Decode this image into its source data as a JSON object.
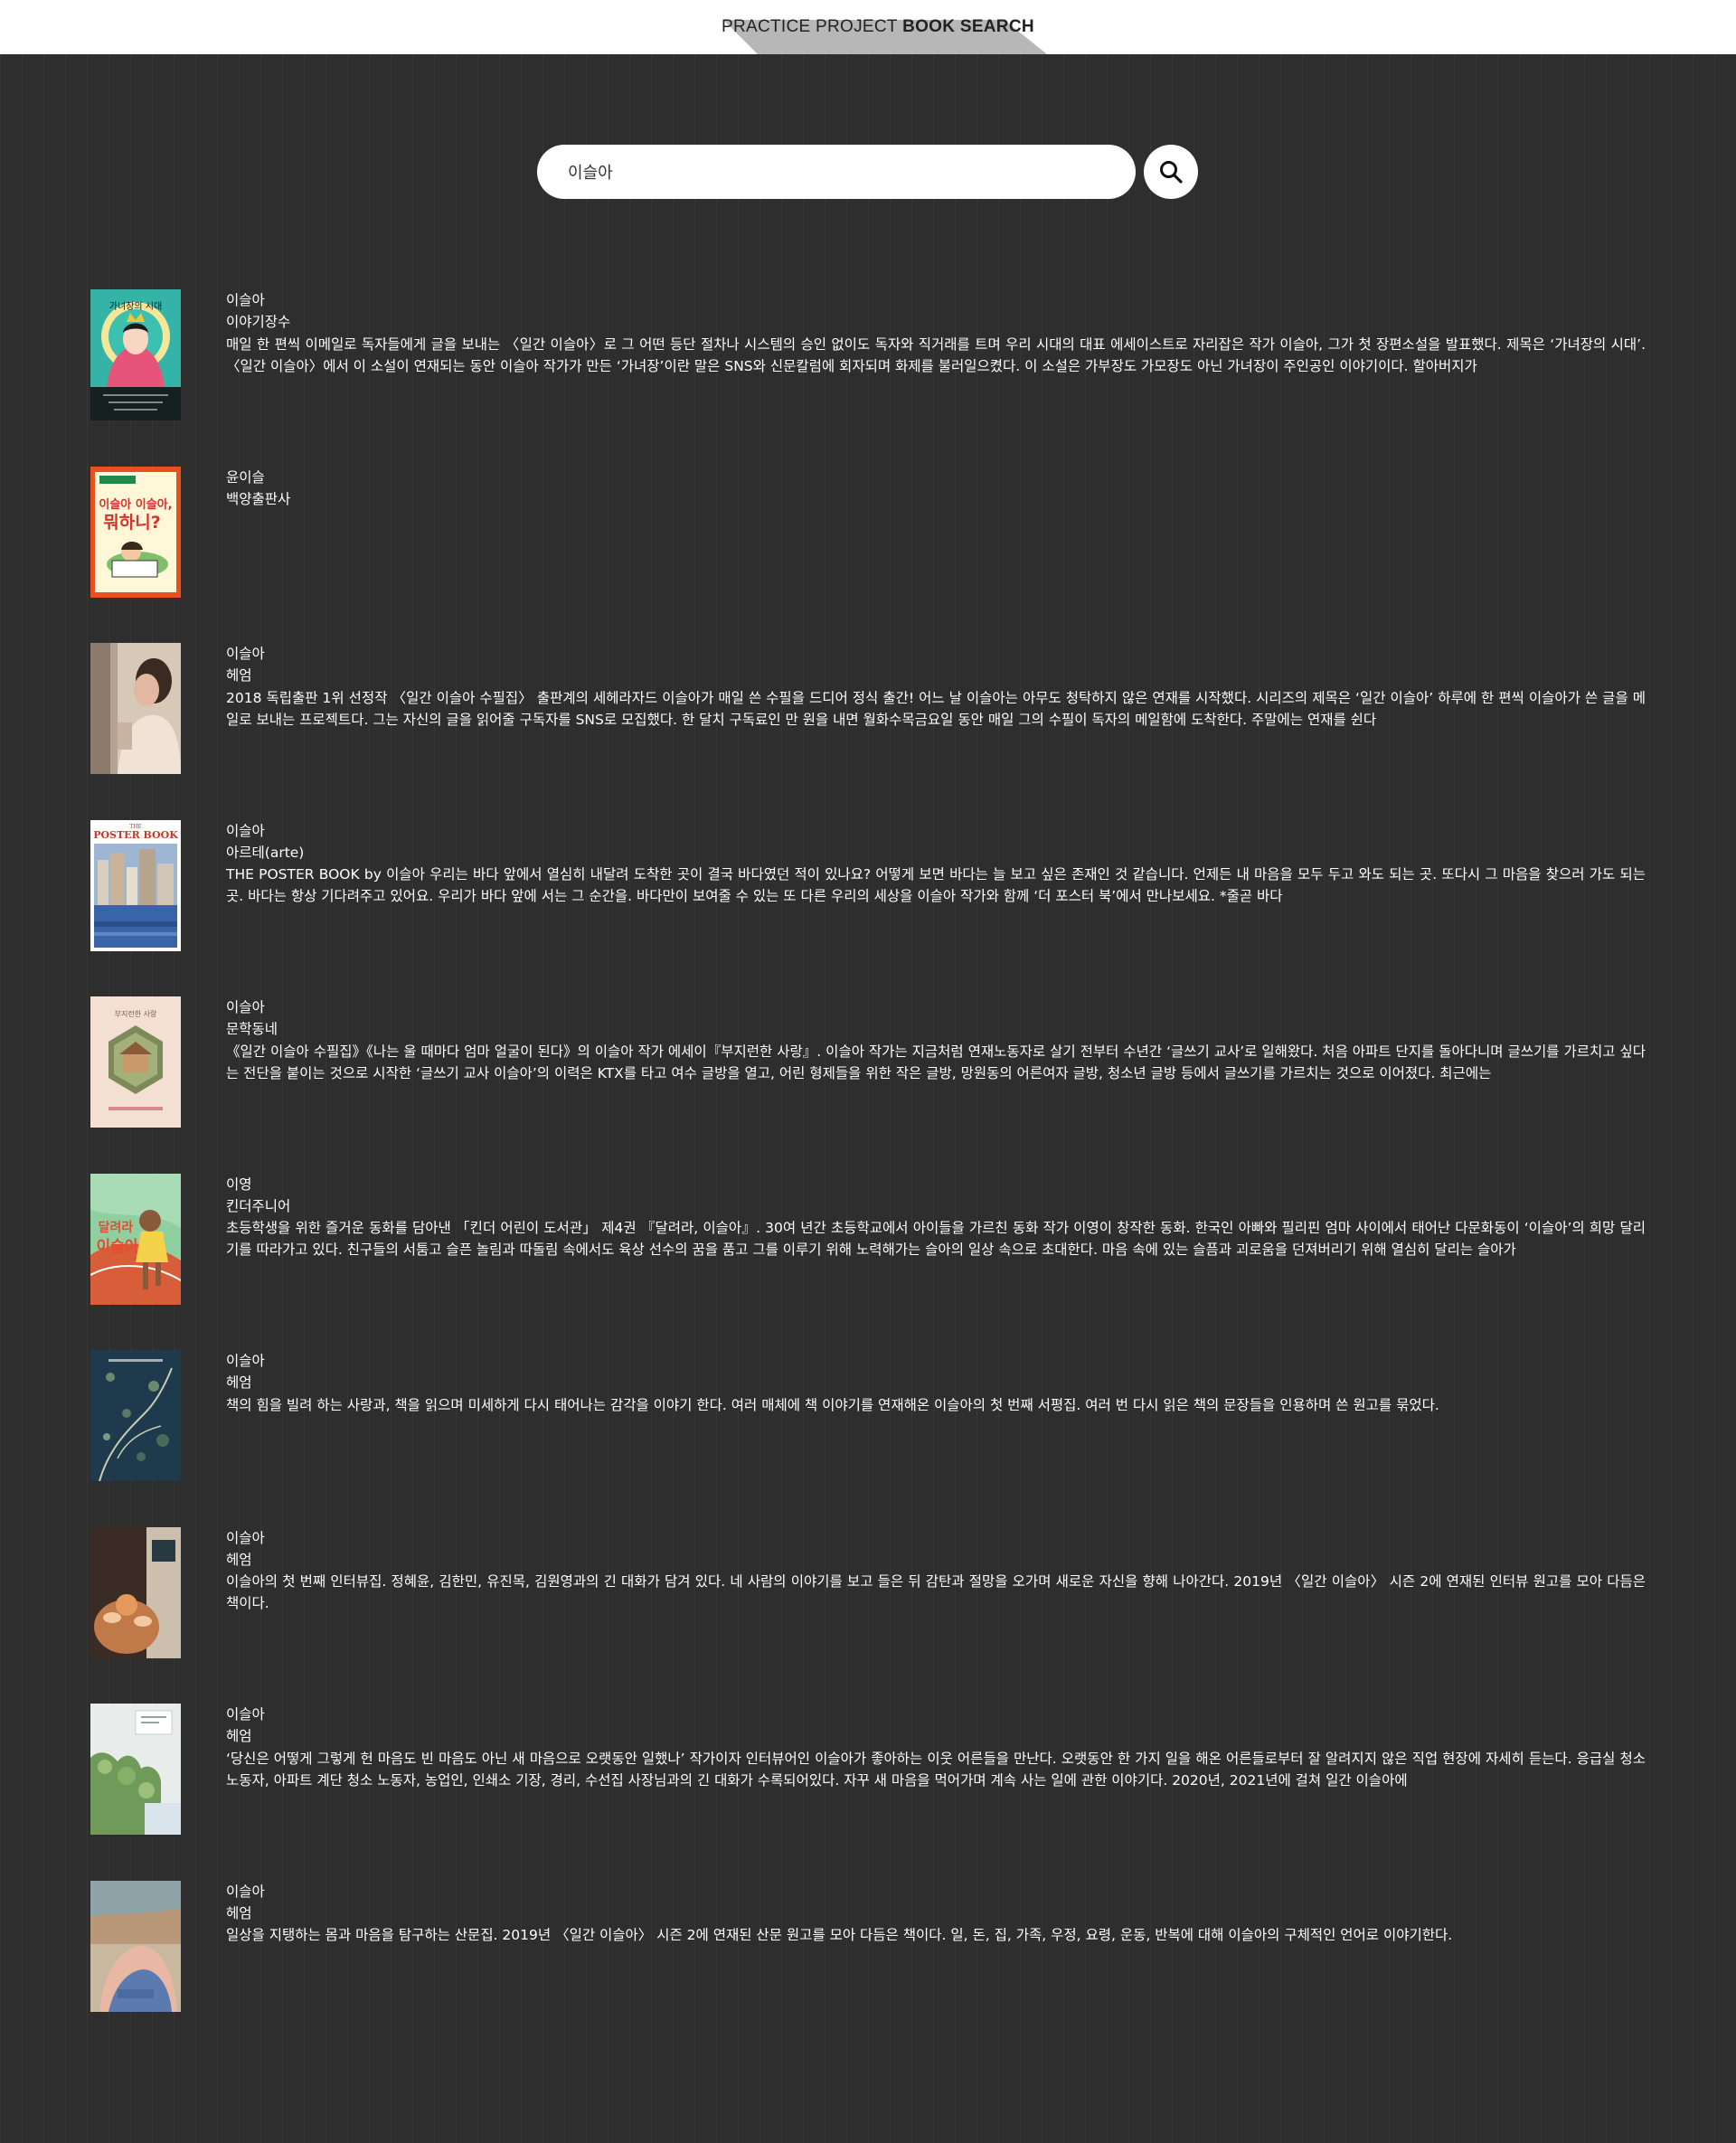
{
  "header": {
    "brand_light": "PRACTICE PROJECT ",
    "brand_bold": "BOOK SEARCH"
  },
  "search": {
    "value": "이슬아",
    "button_icon": "search-icon"
  },
  "books": [
    {
      "author": "이슬아",
      "publisher": "이야기장수",
      "description": "매일 한 편씩 이메일로 독자들에게 글을 보내는 〈일간 이슬아〉로 그 어떤 등단 절차나 시스템의 승인 없이도 독자와 직거래를 트며 우리 시대의 대표 에세이스트로 자리잡은 작가 이슬아, 그가 첫 장편소설을 발표했다. 제목은 ‘가녀장의 시대’. 〈일간 이슬아〉에서 이 소설이 연재되는 동안 이슬아 작가가 만든 ‘가녀장’이란 말은 SNS와 신문칼럼에 회자되며 화제를 불러일으켰다. 이 소설은 가부장도 가모장도 아닌 가녀장이 주인공인 이야기이다. 할아버지가",
      "cover_text": "가녀장의 시대"
    },
    {
      "author": "윤이슬",
      "publisher": "백양출판사",
      "description": "",
      "cover_text": "이슬아 이슬아, 뭐 하니?"
    },
    {
      "author": "이슬아",
      "publisher": "헤엄",
      "description": "2018 독립출판 1위 선정작 〈일간 이슬아 수필집〉 출판계의 세헤라자드 이슬아가 매일 쓴 수필을 드디어 정식 출간! 어느 날 이슬아는 아무도 청탁하지 않은 연재를 시작했다. 시리즈의 제목은 ‘일간 이슬아’ 하루에 한 편씩 이슬아가 쓴 글을 메일로 보내는 프로젝트다. 그는 자신의 글을 읽어줄 구독자를 SNS로 모집했다. 한 달치 구독료인 만 원을 내면 월화수목금요일 동안 매일 그의 수필이 독자의 메일함에 도착한다. 주말에는 연재를 쉰다",
      "cover_text": ""
    },
    {
      "author": "이슬아",
      "publisher": "아르테(arte)",
      "description": "THE POSTER BOOK by 이슬아 우리는 바다 앞에서 열심히 내달려 도착한 곳이 결국 바다였던 적이 있나요? 어떻게 보면 바다는 늘 보고 싶은 존재인 것 같습니다. 언제든 내 마음을 모두 두고 와도 되는 곳. 또다시 그 마음을 찾으러 가도 되는 곳. 바다는 항상 기다려주고 있어요. 우리가 바다 앞에 서는 그 순간을. 바다만이 보여줄 수 있는 또 다른 우리의 세상을 이슬아 작가와 함께 ‘더 포스터 북’에서 만나보세요. *줄곧 바다",
      "cover_text": "THE POSTER BOOK"
    },
    {
      "author": "이슬아",
      "publisher": "문학동네",
      "description": "《일간 이슬아 수필집》《나는 울 때마다 엄마 얼굴이 된다》의 이슬아 작가 에세이『부지런한 사랑』. 이슬아 작가는 지금처럼 연재노동자로 살기 전부터 수년간 ‘글쓰기 교사’로 일해왔다. 처음 아파트 단지를 돌아다니며 글쓰기를 가르치고 싶다는 전단을 붙이는 것으로 시작한 ‘글쓰기 교사 이슬아’의 이력은 KTX를 타고 여수 글방을 열고, 어린 형제들을 위한 작은 글방, 망원동의 어른여자 글방, 청소년 글방 등에서 글쓰기를 가르치는 것으로 이어졌다. 최근에는",
      "cover_text": "부지런한 사랑"
    },
    {
      "author": "이영",
      "publisher": "킨더주니어",
      "description": "초등학생을 위한 즐거운 동화를 담아낸 「킨더 어린이 도서관」 제4권 『달려라, 이슬아』. 30여 년간 초등학교에서 아이들을 가르친 동화 작가 이영이 창작한 동화. 한국인 아빠와 필리핀 엄마 사이에서 태어난 다문화동이 ‘이슬아’의 희망 달리기를 따라가고 있다. 친구들의 서툼고 슬픈 놀림과 따돌림 속에서도 육상 선수의 꿈을 품고 그를 이루기 위해 노력해가는 슬아의 일상 속으로 초대한다. 마음 속에 있는 슬픔과 괴로움을 던져버리기 위해 열심히 달리는 슬아가",
      "cover_text": "달려라 이슬아"
    },
    {
      "author": "이슬아",
      "publisher": "헤엄",
      "description": "책의 힘을 빌려 하는 사랑과, 책을 읽으며 미세하게 다시 태어나는 감각을 이야기 한다. 여러 매체에 책 이야기를 연재해온 이슬아의 첫 번째 서평집. 여러 번 다시 읽은 책의 문장들을 인용하며 쓴 원고를 묶었다.",
      "cover_text": ""
    },
    {
      "author": "이슬아",
      "publisher": "헤엄",
      "description": "이슬아의 첫 번째 인터뷰집. 정혜윤, 김한민, 유진목, 김원영과의 긴 대화가 담겨 있다. 네 사람의 이야기를 보고 들은 뒤 감탄과 절망을 오가며 새로운 자신을 향해 나아간다. 2019년 〈일간 이슬아〉 시즌 2에 연재된 인터뷰 원고를 모아 다듬은 책이다.",
      "cover_text": ""
    },
    {
      "author": "이슬아",
      "publisher": "헤엄",
      "description": "‘당신은 어떻게 그렇게 헌 마음도 빈 마음도 아닌 새 마음으로 오랫동안 일했나’ 작가이자 인터뷰어인 이슬아가 좋아하는 이웃 어른들을 만난다. 오랫동안 한 가지 일을 해온 어른들로부터 잘 알려지지 않은 직업 현장에 자세히 듣는다. 응급실 청소 노동자, 아파트 계단 청소 노동자, 농업인, 인쇄소 기장, 경리, 수선집 사장님과의 긴 대화가 수록되어있다. 자꾸 새 마음을 먹어가며 계속 사는 일에 관한 이야기다. 2020년, 2021년에 걸쳐 일간 이슬아에",
      "cover_text": ""
    },
    {
      "author": "이슬아",
      "publisher": "헤엄",
      "description": "일상을 지탱하는 몸과 마음을 탐구하는 산문집. 2019년 〈일간 이슬아〉 시즌 2에 연재된 산문 원고를 모아 다듬은 책이다. 일, 돈, 집, 가족, 우정, 요령, 운동, 반복에 대해 이슬아의 구체적인 언어로 이야기한다.",
      "cover_text": ""
    }
  ]
}
